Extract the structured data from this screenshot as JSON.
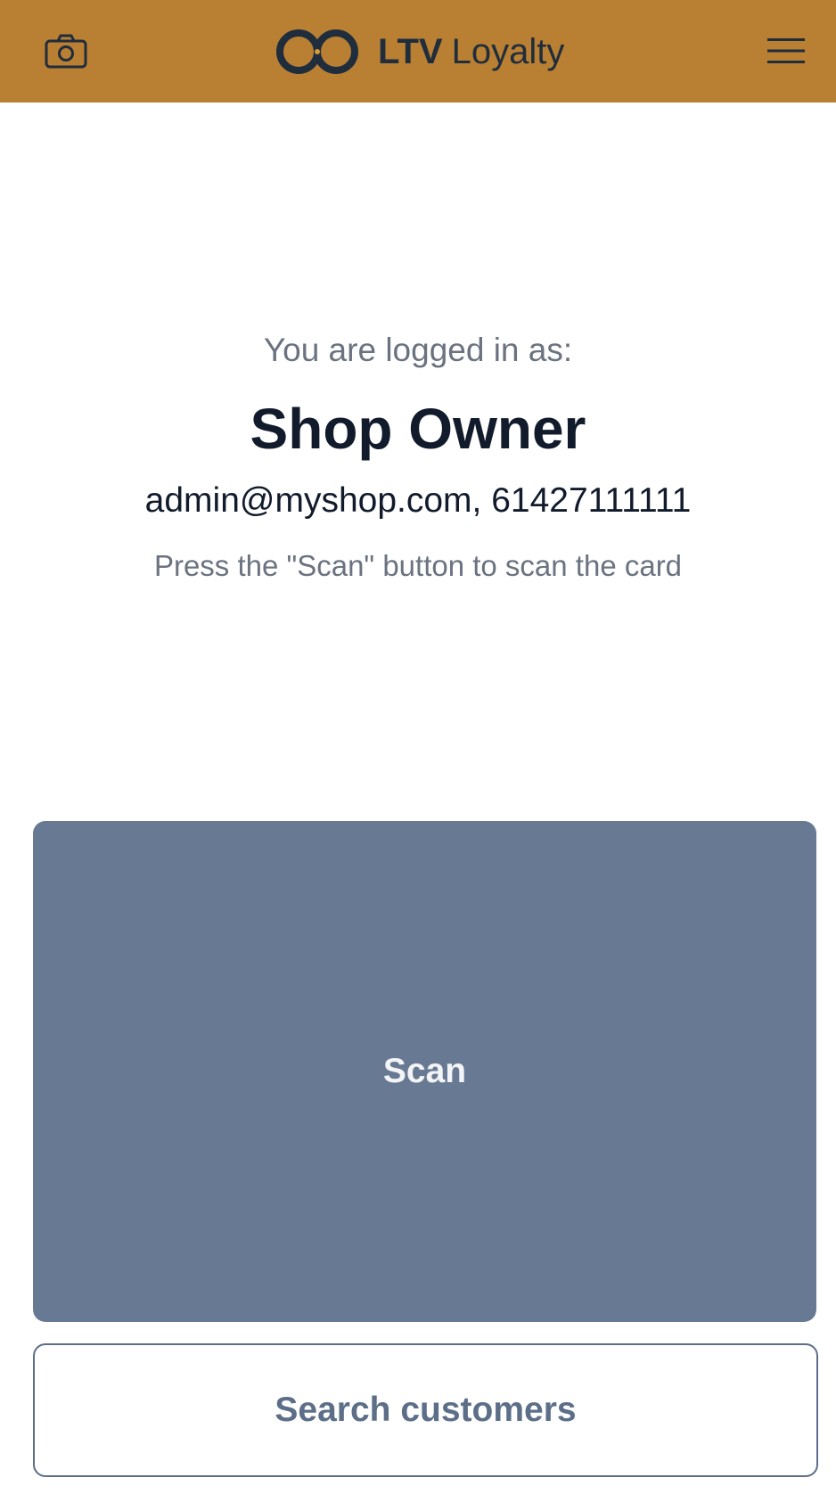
{
  "header": {
    "background": "#b97f32",
    "brand": {
      "bold": "LTV",
      "light": "Loyalty"
    },
    "left_icon": "camera-icon",
    "right_icon": "menu-icon"
  },
  "session": {
    "logged_in_label": "You are logged in as:",
    "user_name": "Shop Owner",
    "contact": "admin@myshop.com, 61427111111",
    "instruction": "Press the \"Scan\" button to scan the card"
  },
  "actions": {
    "scan_label": "Scan",
    "scan_color": "#687a93",
    "search_label": "Search customers"
  }
}
